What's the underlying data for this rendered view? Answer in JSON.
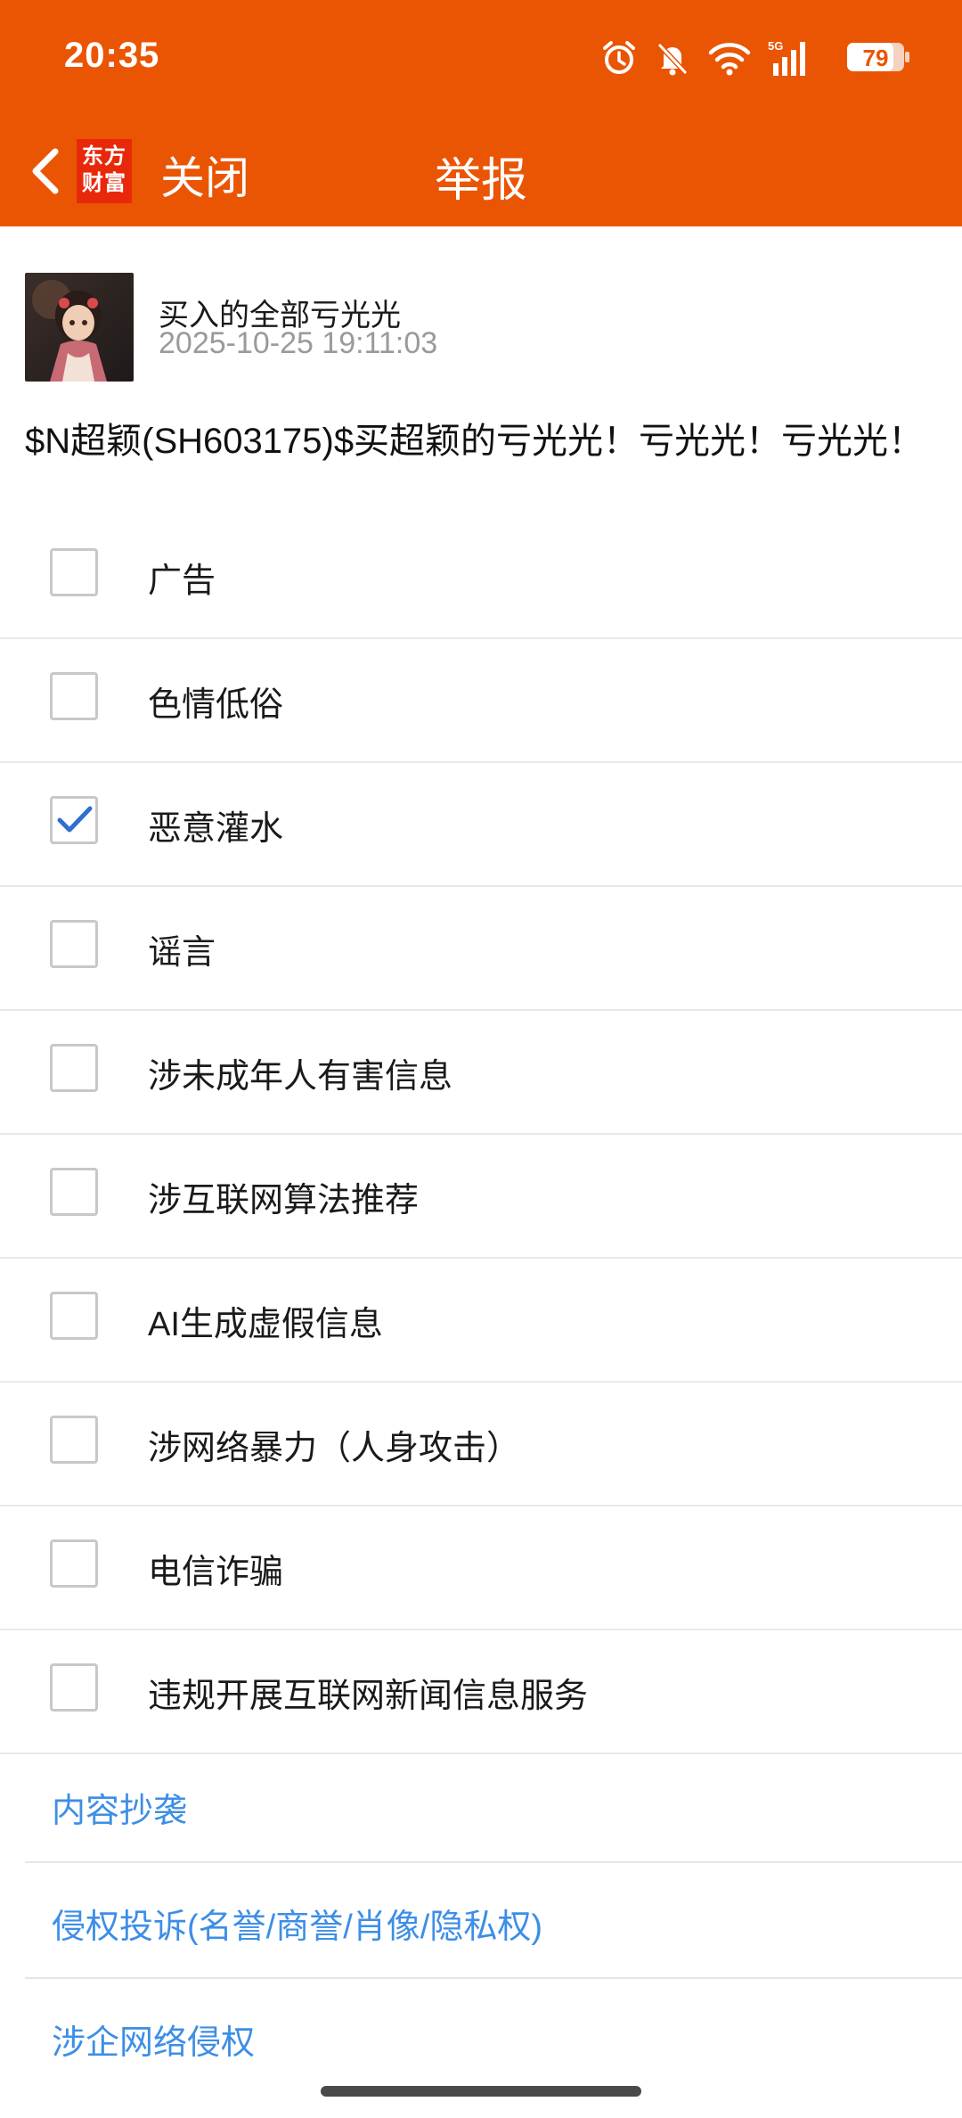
{
  "status_bar": {
    "time": "20:35",
    "battery": "79",
    "network": "5G"
  },
  "nav": {
    "logo_line1": "东方",
    "logo_line2": "财富",
    "close_label": "关闭",
    "title": "举报"
  },
  "post": {
    "author": "买入的全部亏光光",
    "date": "2025-10-25 19:11:03",
    "content": "$N超颖(SH603175)$买超颖的亏光光！亏光光！亏光光！"
  },
  "report_options": [
    {
      "label": "广告",
      "checked": false
    },
    {
      "label": "色情低俗",
      "checked": false
    },
    {
      "label": "恶意灌水",
      "checked": true
    },
    {
      "label": "谣言",
      "checked": false
    },
    {
      "label": "涉未成年人有害信息",
      "checked": false
    },
    {
      "label": "涉互联网算法推荐",
      "checked": false
    },
    {
      "label": "AI生成虚假信息",
      "checked": false
    },
    {
      "label": "涉网络暴力（人身攻击）",
      "checked": false
    },
    {
      "label": "电信诈骗",
      "checked": false
    },
    {
      "label": "违规开展互联网新闻信息服务",
      "checked": false
    }
  ],
  "links": [
    {
      "label": "内容抄袭"
    },
    {
      "label": "侵权投诉(名誉/商誉/肖像/隐私权)"
    },
    {
      "label": "涉企网络侵权"
    }
  ],
  "colors": {
    "header": "#ea5504",
    "link": "#3d8ee6",
    "check": "#2f6fcf"
  }
}
